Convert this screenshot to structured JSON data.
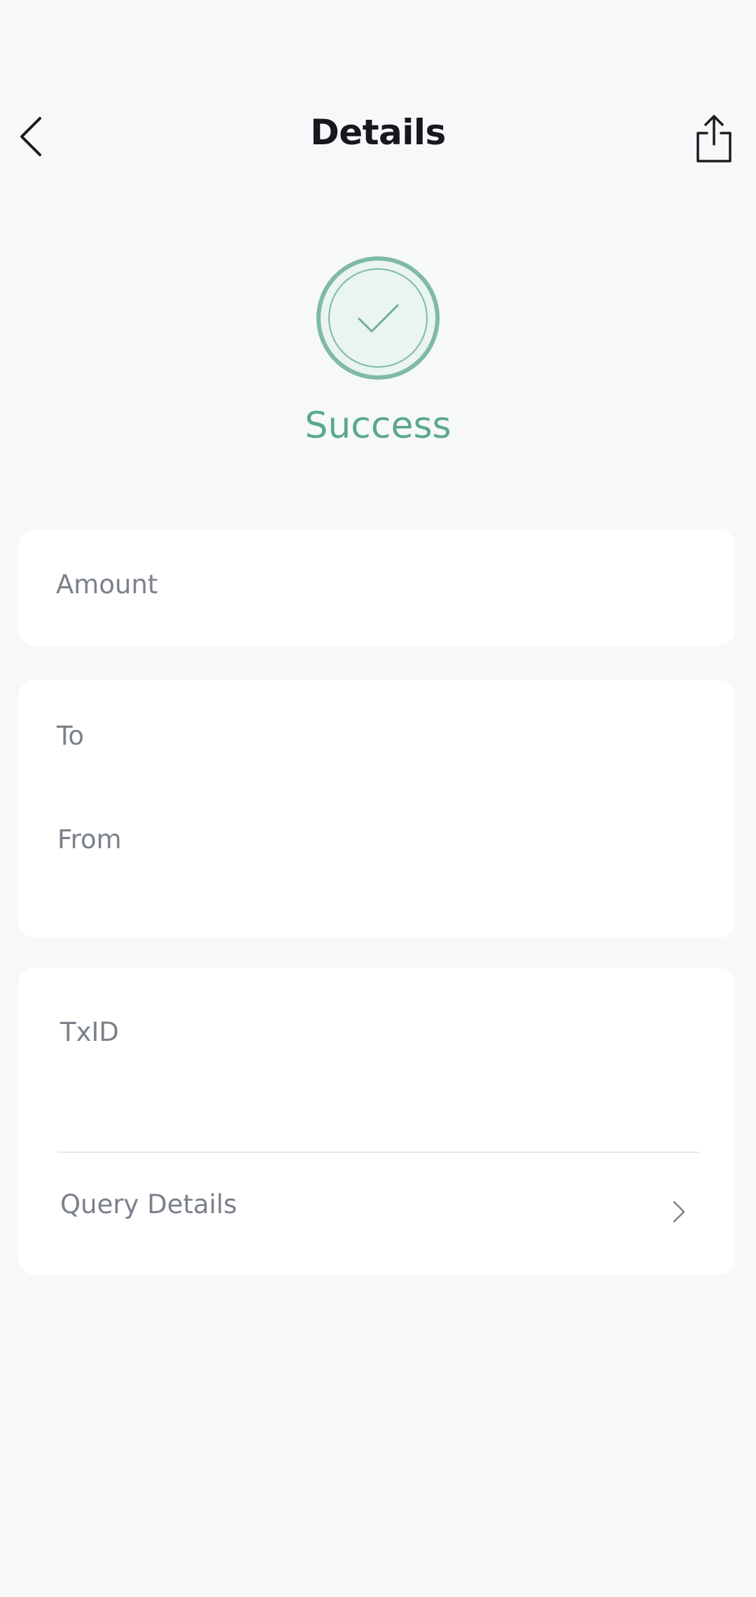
{
  "header": {
    "title": "Details",
    "back_icon": "chevron-left-icon",
    "share_icon": "share-icon"
  },
  "status": {
    "label": "Success",
    "icon": "check-circle-icon",
    "color": "#5aa98a"
  },
  "amount_card": {
    "amount_label": "Amount"
  },
  "parties_card": {
    "to_label": "To",
    "from_label": "From"
  },
  "tx_card": {
    "txid_label": "TxID",
    "query_label": "Query Details",
    "query_icon": "chevron-right-icon"
  }
}
